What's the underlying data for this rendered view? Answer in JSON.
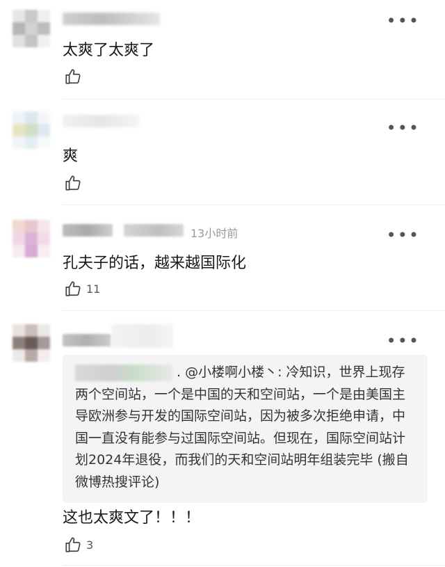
{
  "comments": [
    {
      "text": "太爽了太爽了",
      "likes": ""
    },
    {
      "text": "爽",
      "likes": ""
    },
    {
      "time": "13小时前",
      "text": "孔夫子的话，越来越国际化",
      "likes": "11"
    },
    {
      "quote": ". @小楼啊小楼丶: 冷知识，世界上现存两个空间站，一个是中国的天和空间站，一个是由美国主导欧洲参与开发的国际空间站，因为被多次拒绝申请，中国一直没有能参与过国际空间站。但现在，国际空间站计划2024年退役，而我们的天和空间站明年组装完毕 (搬自微博热搜评论)",
      "text": "这也太爽文了！！！",
      "likes": "3"
    }
  ],
  "more_icon": "•••",
  "icons": {
    "like": "thumbs-up-icon",
    "more": "more-icon"
  }
}
